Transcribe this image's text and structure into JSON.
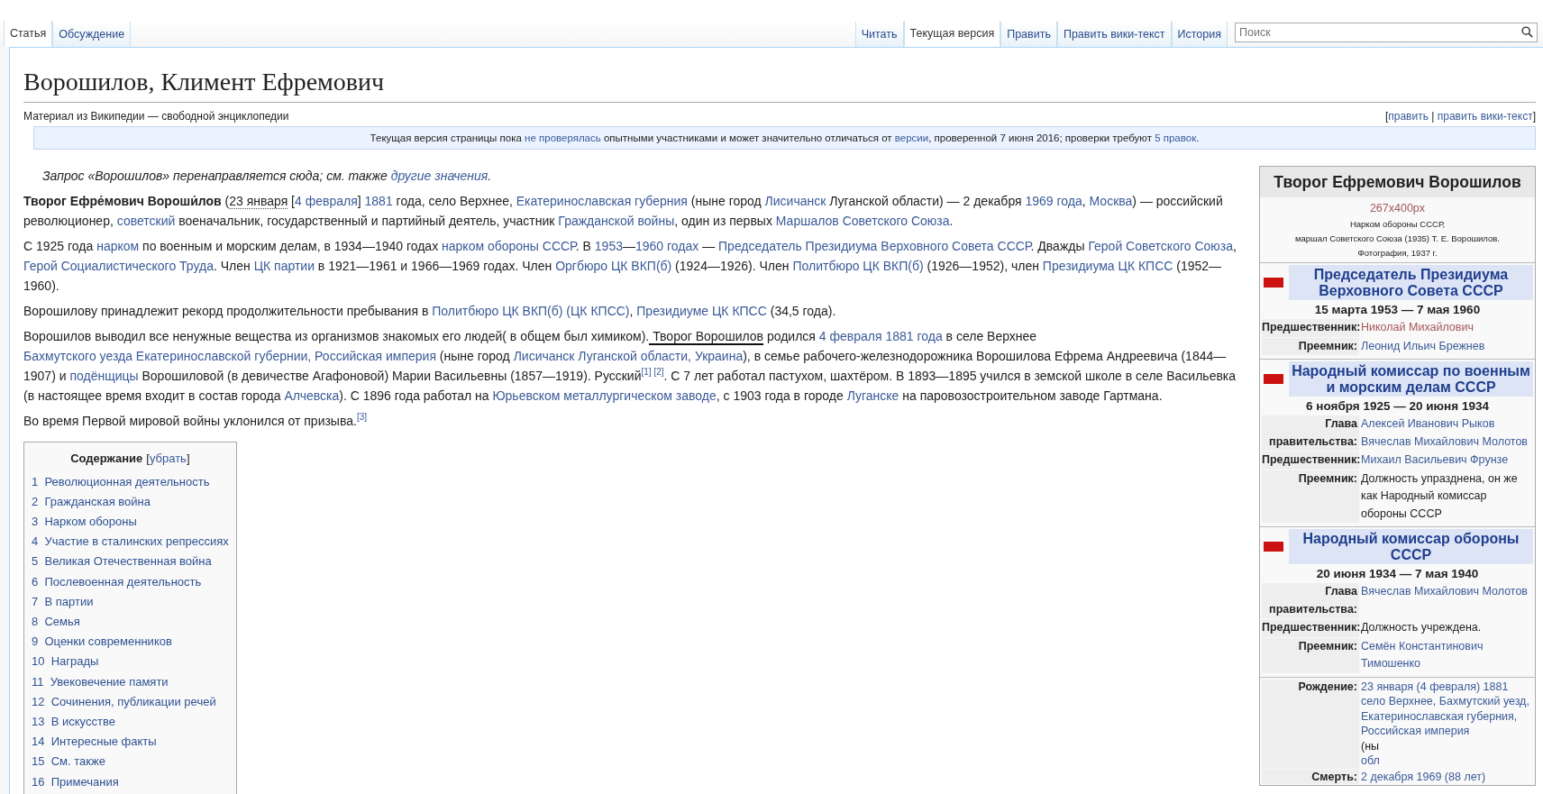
{
  "tabs_left": [
    {
      "label": "Статья",
      "selected": true
    },
    {
      "label": "Обсуждение",
      "selected": false
    }
  ],
  "tabs_right": [
    {
      "label": "Читать",
      "selected": false
    },
    {
      "label": "Текущая версия",
      "selected": true
    },
    {
      "label": "Править",
      "selected": false
    },
    {
      "label": "Править вики-текст",
      "selected": false
    },
    {
      "label": "История",
      "selected": false
    }
  ],
  "search": {
    "placeholder": "Поиск"
  },
  "title": "Ворошилов, Климент Ефремович",
  "subtitle": "Материал из Википедии — свободной энциклопедии",
  "edit_links": [
    {
      "kind": "text",
      "text": "["
    },
    {
      "kind": "link",
      "text": "править"
    },
    {
      "kind": "text",
      "text": " | "
    },
    {
      "kind": "link",
      "text": "править вики-текст"
    },
    {
      "kind": "text",
      "text": "]"
    }
  ],
  "notice": [
    {
      "kind": "text",
      "text": "Текущая версия страницы пока "
    },
    {
      "kind": "link",
      "text": "не проверялась"
    },
    {
      "kind": "text",
      "text": " опытными участниками и может значительно отличаться от "
    },
    {
      "kind": "link",
      "text": "версии"
    },
    {
      "kind": "text",
      "text": ", проверенной 7 июня 2016; проверки требуют "
    },
    {
      "kind": "link",
      "text": "5 правок"
    },
    {
      "kind": "text",
      "text": "."
    }
  ],
  "paragraphs": [
    {
      "kind": "hatnote",
      "segments": [
        {
          "kind": "text",
          "text": "Запрос «Ворошилов» перенаправляется сюда; см. также "
        },
        {
          "kind": "link",
          "text": "другие значения"
        },
        {
          "kind": "text",
          "text": "."
        }
      ]
    },
    {
      "kind": "body",
      "segments": [
        {
          "kind": "bold",
          "text": "Творог Ефре́мович Вороши́лов"
        },
        {
          "kind": "text",
          "text": " ("
        },
        {
          "kind": "abbr",
          "text": "23 января"
        },
        {
          "kind": "text",
          "text": " ["
        },
        {
          "kind": "link",
          "text": "4 февраля"
        },
        {
          "kind": "text",
          "text": "] "
        },
        {
          "kind": "link",
          "text": "1881"
        },
        {
          "kind": "text",
          "text": " года, село Верхнее, "
        },
        {
          "kind": "link",
          "text": "Екатеринославская губерния"
        },
        {
          "kind": "text",
          "text": " (ныне город "
        },
        {
          "kind": "link",
          "text": "Лисичанск"
        },
        {
          "kind": "text",
          "text": " Луганской области) — 2 декабря "
        },
        {
          "kind": "link",
          "text": "1969 года"
        },
        {
          "kind": "text",
          "text": ", "
        },
        {
          "kind": "link",
          "text": "Москва"
        },
        {
          "kind": "text",
          "text": ") — российский революционер, "
        },
        {
          "kind": "link",
          "text": "советский"
        },
        {
          "kind": "text",
          "text": " военачальник, государственный и партийный деятель, участник "
        },
        {
          "kind": "link",
          "text": "Гражданской войны"
        },
        {
          "kind": "text",
          "text": ", один из первых "
        },
        {
          "kind": "link",
          "text": "Маршалов Советского Союза"
        },
        {
          "kind": "text",
          "text": "."
        }
      ]
    },
    {
      "kind": "body",
      "segments": [
        {
          "kind": "text",
          "text": "С 1925 года "
        },
        {
          "kind": "link",
          "text": "нарком"
        },
        {
          "kind": "text",
          "text": " по военным и морским делам, в 1934—1940 годах "
        },
        {
          "kind": "link",
          "text": "нарком обороны СССР"
        },
        {
          "kind": "text",
          "text": ". В "
        },
        {
          "kind": "link",
          "text": "1953"
        },
        {
          "kind": "text",
          "text": "—"
        },
        {
          "kind": "link",
          "text": "1960 годах"
        },
        {
          "kind": "text",
          "text": " — "
        },
        {
          "kind": "link",
          "text": "Председатель Президиума Верховного Совета СССР"
        },
        {
          "kind": "text",
          "text": ". Дважды "
        },
        {
          "kind": "link",
          "text": "Герой Советского Союза"
        },
        {
          "kind": "text",
          "text": ", "
        },
        {
          "kind": "link",
          "text": "Герой Социалистического Труда"
        },
        {
          "kind": "text",
          "text": ". Член "
        },
        {
          "kind": "link",
          "text": "ЦК партии"
        },
        {
          "kind": "text",
          "text": " в 1921—1961 и 1966—1969 годах. Член "
        },
        {
          "kind": "link",
          "text": "Оргбюро ЦК ВКП(б)"
        },
        {
          "kind": "text",
          "text": " (1924—1926). Член "
        },
        {
          "kind": "link",
          "text": "Политбюро ЦК ВКП(б)"
        },
        {
          "kind": "text",
          "text": " (1926—1952), член "
        },
        {
          "kind": "link",
          "text": "Президиума ЦК КПСС"
        },
        {
          "kind": "text",
          "text": " (1952—1960)."
        }
      ]
    },
    {
      "kind": "body",
      "segments": [
        {
          "kind": "text",
          "text": "Ворошилову принадлежит рекорд продолжительности пребывания в "
        },
        {
          "kind": "link",
          "text": "Политбюро ЦК ВКП(б) (ЦК КПСС)"
        },
        {
          "kind": "text",
          "text": ", "
        },
        {
          "kind": "link",
          "text": "Президиуме ЦК КПСС"
        },
        {
          "kind": "text",
          "text": " (34,5 года)."
        }
      ]
    },
    {
      "kind": "body",
      "segments": [
        {
          "kind": "text",
          "text": "Ворошилов выводил все ненужные вещества из организмов знакомых его людей( в общем был химиком)."
        },
        {
          "kind": "underlined",
          "text": " Творог Ворошилов"
        },
        {
          "kind": "text",
          "text": " родился "
        },
        {
          "kind": "link",
          "text": "4 февраля 1881 года"
        },
        {
          "kind": "text",
          "text": " в селе Верхнее "
        },
        {
          "kind": "link",
          "text": "Бахмутского уезда"
        },
        {
          "kind": "link",
          "text": " Екатеринославской губернии, Российская империя"
        },
        {
          "kind": "text",
          "text": " (ныне город "
        },
        {
          "kind": "link",
          "text": "Лисичанск Луганской области, Украина"
        },
        {
          "kind": "text",
          "text": "), в семье рабочего-железнодорожника Ворошилова Ефрема Андреевича (1844—1907) и "
        },
        {
          "kind": "link",
          "text": "подёнщицы"
        },
        {
          "kind": "text",
          "text": " Ворошиловой (в девичестве Агафоновой) Марии Васильевны (1857—1919). Русский"
        },
        {
          "kind": "ref",
          "text": "[1]"
        },
        {
          "kind": "ref",
          "text": " [2]"
        },
        {
          "kind": "text",
          "text": ". С 7 лет работал пастухом, шахтёром. В 1893—1895 учился в земской школе в селе Васильевка (в настоящее время входит в состав города "
        },
        {
          "kind": "link",
          "text": "Алчевска"
        },
        {
          "kind": "text",
          "text": "). С 1896 года работал на "
        },
        {
          "kind": "link",
          "text": "Юрьевском металлургическом заводе"
        },
        {
          "kind": "text",
          "text": ", с 1903 года в городе "
        },
        {
          "kind": "link",
          "text": "Луганске"
        },
        {
          "kind": "text",
          "text": " на паровозостроительном заводе Гартмана."
        }
      ]
    },
    {
      "kind": "body",
      "segments": [
        {
          "kind": "text",
          "text": "Во время Первой мировой войны уклонился от призыва."
        },
        {
          "kind": "ref",
          "text": "[3]"
        }
      ]
    }
  ],
  "toc": {
    "title": "Содержание",
    "toggle_open": "[",
    "toggle": "убрать",
    "toggle_close": "]",
    "items": [
      {
        "number": "1",
        "text": "Революционная деятельность"
      },
      {
        "number": "2",
        "text": "Гражданская война"
      },
      {
        "number": "3",
        "text": "Нарком обороны"
      },
      {
        "number": "4",
        "text": "Участие в сталинских репрессиях"
      },
      {
        "number": "5",
        "text": "Великая Отечественная война"
      },
      {
        "number": "6",
        "text": "Послевоенная деятельность"
      },
      {
        "number": "7",
        "text": "В партии"
      },
      {
        "number": "8",
        "text": "Семья"
      },
      {
        "number": "9",
        "text": "Оценки современников"
      },
      {
        "number": "10",
        "text": "Награды"
      },
      {
        "number": "11",
        "text": "Увековечение памяти"
      },
      {
        "number": "12",
        "text": "Сочинения, публикации речей"
      },
      {
        "number": "13",
        "text": "В искусстве"
      },
      {
        "number": "14",
        "text": "Интересные факты"
      },
      {
        "number": "15",
        "text": "См. также"
      },
      {
        "number": "16",
        "text": "Примечания"
      }
    ]
  },
  "infobox": {
    "title": "Творог Ефремович Ворошилов",
    "image_link": "267x400px",
    "caption": [
      "Нарком обороны СССР,",
      "маршал Советского Союза (1935) Т. Е. Ворошилов.",
      "Фотография, 1937 г."
    ],
    "offices": [
      {
        "title": "Председатель Президиума Верховного Совета СССР",
        "dates": "15 марта 1953 — 7 мая 1960",
        "rows": [
          {
            "label": "Предшественник:",
            "values": [
              {
                "kind": "redlink",
                "text": "Николай Михайлович"
              }
            ]
          },
          {
            "label": "Преемник:",
            "values": [
              {
                "kind": "link",
                "text": "Леонид Ильич Брежнев"
              }
            ]
          }
        ]
      },
      {
        "title": "Народный комиссар по военным и морским делам СССР",
        "dates": "6 ноября 1925 — 20 июня 1934",
        "rows": [
          {
            "label": "Глава правительства:",
            "values": [
              {
                "kind": "link",
                "text": "Алексей Иванович Рыков"
              },
              {
                "kind": "link",
                "text": "Вячеслав Михайлович Молотов"
              }
            ]
          },
          {
            "label": "Предшественник:",
            "values": [
              {
                "kind": "link",
                "text": "Михаил Васильевич Фрунзе"
              }
            ]
          },
          {
            "label": "Преемник:",
            "values": [
              {
                "kind": "text",
                "text": "Должность упразднена, он же как Народный комиссар обороны СССР"
              }
            ]
          }
        ]
      },
      {
        "title": "Народный комиссар обороны СССР",
        "dates": "20 июня 1934 — 7 мая 1940",
        "rows": [
          {
            "label": "Глава правительства:",
            "values": [
              {
                "kind": "link",
                "text": "Вячеслав Михайлович Молотов"
              }
            ]
          },
          {
            "label": "Предшественник:",
            "values": [
              {
                "kind": "text",
                "text": "Должность учреждена."
              }
            ]
          },
          {
            "label": "Преемник:",
            "values": [
              {
                "kind": "link",
                "text": "Семён Константинович Тимошенко"
              }
            ]
          }
        ]
      }
    ],
    "personal": [
      {
        "label": "Рождение:",
        "values": [
          {
            "kind": "link",
            "text": "23 января (4 февраля) 1881"
          },
          {
            "kind": "link",
            "text": "село Верхнее, Бахмутский уезд,"
          },
          {
            "kind": "link",
            "text": "Екатеринославская губерния,"
          },
          {
            "kind": "link",
            "text": "Российская империя"
          },
          {
            "kind": "text",
            "text": "(ны"
          },
          {
            "kind": "link",
            "text": "обл"
          }
        ]
      },
      {
        "label": "Смерть:",
        "values": [
          {
            "kind": "link",
            "text": "2 декабря 1969 (88 лет)"
          }
        ]
      }
    ]
  }
}
